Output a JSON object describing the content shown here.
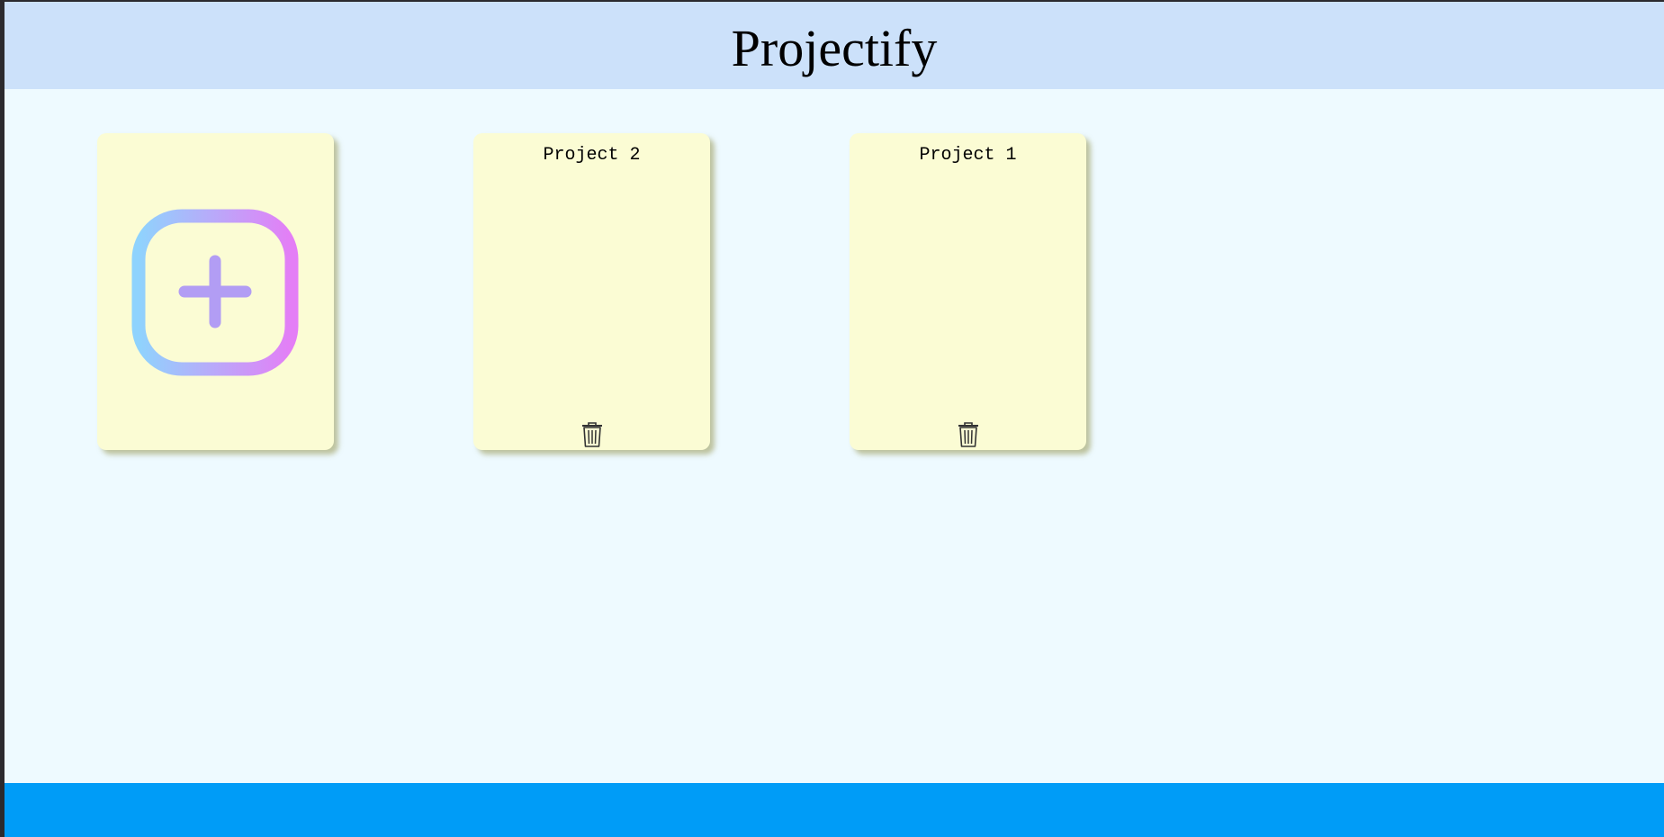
{
  "header": {
    "title": "Projectify"
  },
  "projects": [
    {
      "name": "Project 2",
      "delete_icon": "trash-icon"
    },
    {
      "name": "Project 1",
      "delete_icon": "trash-icon"
    }
  ],
  "add_card": {
    "icon": "plus-square-icon"
  },
  "colors": {
    "header_bg": "#cce1fa",
    "page_bg": "#eefaff",
    "card_bg": "#fbfcd4",
    "footer_bg": "#009cf7",
    "add_gradient_start": "#8fd3fd",
    "add_gradient_end": "#e47ef6",
    "plus_color": "#b29df4"
  }
}
